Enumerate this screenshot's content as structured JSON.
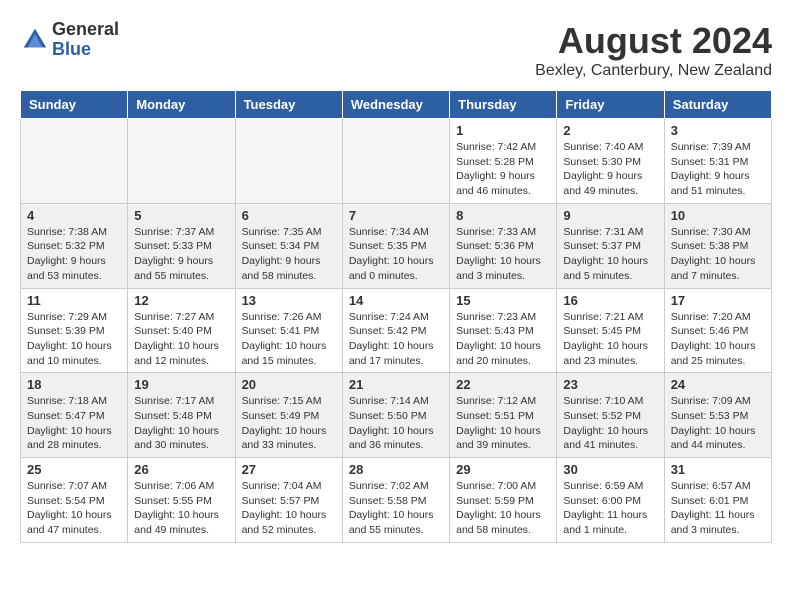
{
  "header": {
    "logo_general": "General",
    "logo_blue": "Blue",
    "month_title": "August 2024",
    "location": "Bexley, Canterbury, New Zealand"
  },
  "days_of_week": [
    "Sunday",
    "Monday",
    "Tuesday",
    "Wednesday",
    "Thursday",
    "Friday",
    "Saturday"
  ],
  "weeks": [
    {
      "id": "week1",
      "days": [
        {
          "num": "",
          "info": "",
          "empty": true
        },
        {
          "num": "",
          "info": "",
          "empty": true
        },
        {
          "num": "",
          "info": "",
          "empty": true
        },
        {
          "num": "",
          "info": "",
          "empty": true
        },
        {
          "num": "1",
          "info": "Sunrise: 7:42 AM\nSunset: 5:28 PM\nDaylight: 9 hours\nand 46 minutes.",
          "empty": false
        },
        {
          "num": "2",
          "info": "Sunrise: 7:40 AM\nSunset: 5:30 PM\nDaylight: 9 hours\nand 49 minutes.",
          "empty": false
        },
        {
          "num": "3",
          "info": "Sunrise: 7:39 AM\nSunset: 5:31 PM\nDaylight: 9 hours\nand 51 minutes.",
          "empty": false
        }
      ]
    },
    {
      "id": "week2",
      "days": [
        {
          "num": "4",
          "info": "Sunrise: 7:38 AM\nSunset: 5:32 PM\nDaylight: 9 hours\nand 53 minutes.",
          "empty": false
        },
        {
          "num": "5",
          "info": "Sunrise: 7:37 AM\nSunset: 5:33 PM\nDaylight: 9 hours\nand 55 minutes.",
          "empty": false
        },
        {
          "num": "6",
          "info": "Sunrise: 7:35 AM\nSunset: 5:34 PM\nDaylight: 9 hours\nand 58 minutes.",
          "empty": false
        },
        {
          "num": "7",
          "info": "Sunrise: 7:34 AM\nSunset: 5:35 PM\nDaylight: 10 hours\nand 0 minutes.",
          "empty": false
        },
        {
          "num": "8",
          "info": "Sunrise: 7:33 AM\nSunset: 5:36 PM\nDaylight: 10 hours\nand 3 minutes.",
          "empty": false
        },
        {
          "num": "9",
          "info": "Sunrise: 7:31 AM\nSunset: 5:37 PM\nDaylight: 10 hours\nand 5 minutes.",
          "empty": false
        },
        {
          "num": "10",
          "info": "Sunrise: 7:30 AM\nSunset: 5:38 PM\nDaylight: 10 hours\nand 7 minutes.",
          "empty": false
        }
      ]
    },
    {
      "id": "week3",
      "days": [
        {
          "num": "11",
          "info": "Sunrise: 7:29 AM\nSunset: 5:39 PM\nDaylight: 10 hours\nand 10 minutes.",
          "empty": false
        },
        {
          "num": "12",
          "info": "Sunrise: 7:27 AM\nSunset: 5:40 PM\nDaylight: 10 hours\nand 12 minutes.",
          "empty": false
        },
        {
          "num": "13",
          "info": "Sunrise: 7:26 AM\nSunset: 5:41 PM\nDaylight: 10 hours\nand 15 minutes.",
          "empty": false
        },
        {
          "num": "14",
          "info": "Sunrise: 7:24 AM\nSunset: 5:42 PM\nDaylight: 10 hours\nand 17 minutes.",
          "empty": false
        },
        {
          "num": "15",
          "info": "Sunrise: 7:23 AM\nSunset: 5:43 PM\nDaylight: 10 hours\nand 20 minutes.",
          "empty": false
        },
        {
          "num": "16",
          "info": "Sunrise: 7:21 AM\nSunset: 5:45 PM\nDaylight: 10 hours\nand 23 minutes.",
          "empty": false
        },
        {
          "num": "17",
          "info": "Sunrise: 7:20 AM\nSunset: 5:46 PM\nDaylight: 10 hours\nand 25 minutes.",
          "empty": false
        }
      ]
    },
    {
      "id": "week4",
      "days": [
        {
          "num": "18",
          "info": "Sunrise: 7:18 AM\nSunset: 5:47 PM\nDaylight: 10 hours\nand 28 minutes.",
          "empty": false
        },
        {
          "num": "19",
          "info": "Sunrise: 7:17 AM\nSunset: 5:48 PM\nDaylight: 10 hours\nand 30 minutes.",
          "empty": false
        },
        {
          "num": "20",
          "info": "Sunrise: 7:15 AM\nSunset: 5:49 PM\nDaylight: 10 hours\nand 33 minutes.",
          "empty": false
        },
        {
          "num": "21",
          "info": "Sunrise: 7:14 AM\nSunset: 5:50 PM\nDaylight: 10 hours\nand 36 minutes.",
          "empty": false
        },
        {
          "num": "22",
          "info": "Sunrise: 7:12 AM\nSunset: 5:51 PM\nDaylight: 10 hours\nand 39 minutes.",
          "empty": false
        },
        {
          "num": "23",
          "info": "Sunrise: 7:10 AM\nSunset: 5:52 PM\nDaylight: 10 hours\nand 41 minutes.",
          "empty": false
        },
        {
          "num": "24",
          "info": "Sunrise: 7:09 AM\nSunset: 5:53 PM\nDaylight: 10 hours\nand 44 minutes.",
          "empty": false
        }
      ]
    },
    {
      "id": "week5",
      "days": [
        {
          "num": "25",
          "info": "Sunrise: 7:07 AM\nSunset: 5:54 PM\nDaylight: 10 hours\nand 47 minutes.",
          "empty": false
        },
        {
          "num": "26",
          "info": "Sunrise: 7:06 AM\nSunset: 5:55 PM\nDaylight: 10 hours\nand 49 minutes.",
          "empty": false
        },
        {
          "num": "27",
          "info": "Sunrise: 7:04 AM\nSunset: 5:57 PM\nDaylight: 10 hours\nand 52 minutes.",
          "empty": false
        },
        {
          "num": "28",
          "info": "Sunrise: 7:02 AM\nSunset: 5:58 PM\nDaylight: 10 hours\nand 55 minutes.",
          "empty": false
        },
        {
          "num": "29",
          "info": "Sunrise: 7:00 AM\nSunset: 5:59 PM\nDaylight: 10 hours\nand 58 minutes.",
          "empty": false
        },
        {
          "num": "30",
          "info": "Sunrise: 6:59 AM\nSunset: 6:00 PM\nDaylight: 11 hours\nand 1 minute.",
          "empty": false
        },
        {
          "num": "31",
          "info": "Sunrise: 6:57 AM\nSunset: 6:01 PM\nDaylight: 11 hours\nand 3 minutes.",
          "empty": false
        }
      ]
    }
  ]
}
